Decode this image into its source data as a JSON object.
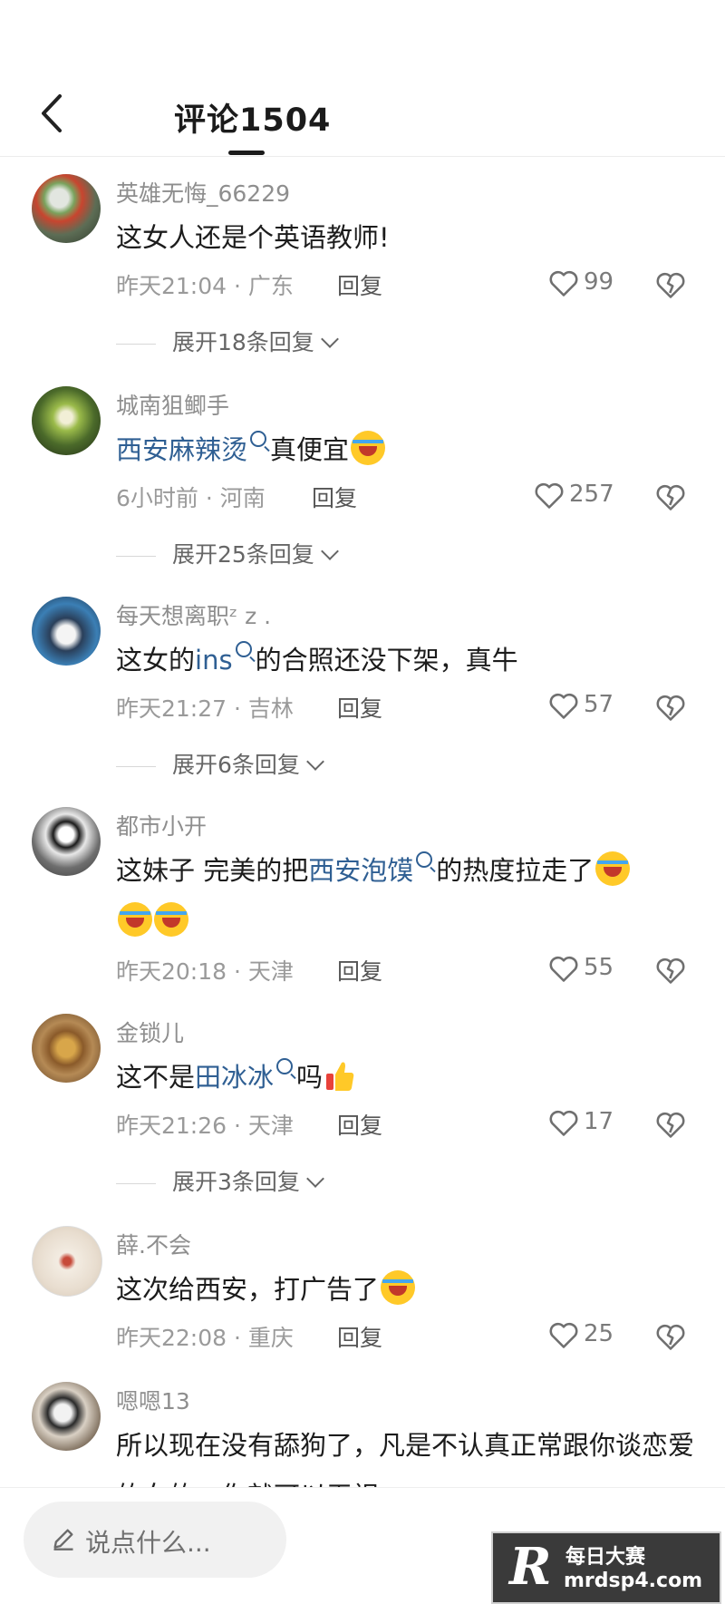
{
  "header": {
    "title": "评论1504"
  },
  "colors": {
    "link": "#2f5f93",
    "meta": "#9a9a9a",
    "text": "#1c1c1c"
  },
  "comments": [
    {
      "user": "英雄无悔_66229",
      "text": "这女人还是个英语教师!",
      "time": "昨天21:04 · 广东",
      "reply": "回复",
      "likes": "99",
      "expand": "展开18条回复"
    },
    {
      "user": "城南狙鲫手",
      "link": "西安麻辣烫",
      "after": "真便宜",
      "time": "6小时前 · 河南",
      "reply": "回复",
      "likes": "257",
      "expand": "展开25条回复"
    },
    {
      "user": "每天想离职ᶻ z .",
      "before": "这女的",
      "link": "ins",
      "after": "的合照还没下架，真牛",
      "time": "昨天21:27 · 吉林",
      "reply": "回复",
      "likes": "57",
      "expand": "展开6条回复"
    },
    {
      "user": "都市小开",
      "before": "这妹子 完美的把",
      "link": "西安泡馍",
      "after": "的热度拉走了",
      "time": "昨天20:18 · 天津",
      "reply": "回复",
      "likes": "55"
    },
    {
      "user": "金锁儿",
      "before": "这不是",
      "link": "田冰冰",
      "after": "吗",
      "time": "昨天21:26 · 天津",
      "reply": "回复",
      "likes": "17",
      "expand": "展开3条回复"
    },
    {
      "user": "薛.不会",
      "text": "这次给西安，打广告了",
      "time": "昨天22:08 · 重庆",
      "reply": "回复",
      "likes": "25"
    },
    {
      "user": "嗯嗯13",
      "text": "所以现在没有舔狗了，凡是不认真正常跟你谈恋爱的女的，你就可以无视"
    }
  ],
  "input": {
    "placeholder": "说点什么..."
  },
  "watermark": {
    "letter": "R",
    "name": "每日大赛",
    "url": "mrdsp4.com"
  },
  "icons": {
    "back": "chevron-left-icon",
    "like": "heart-icon",
    "dislike": "broken-heart-icon",
    "edit": "pencil-icon",
    "search": "search-icon"
  }
}
